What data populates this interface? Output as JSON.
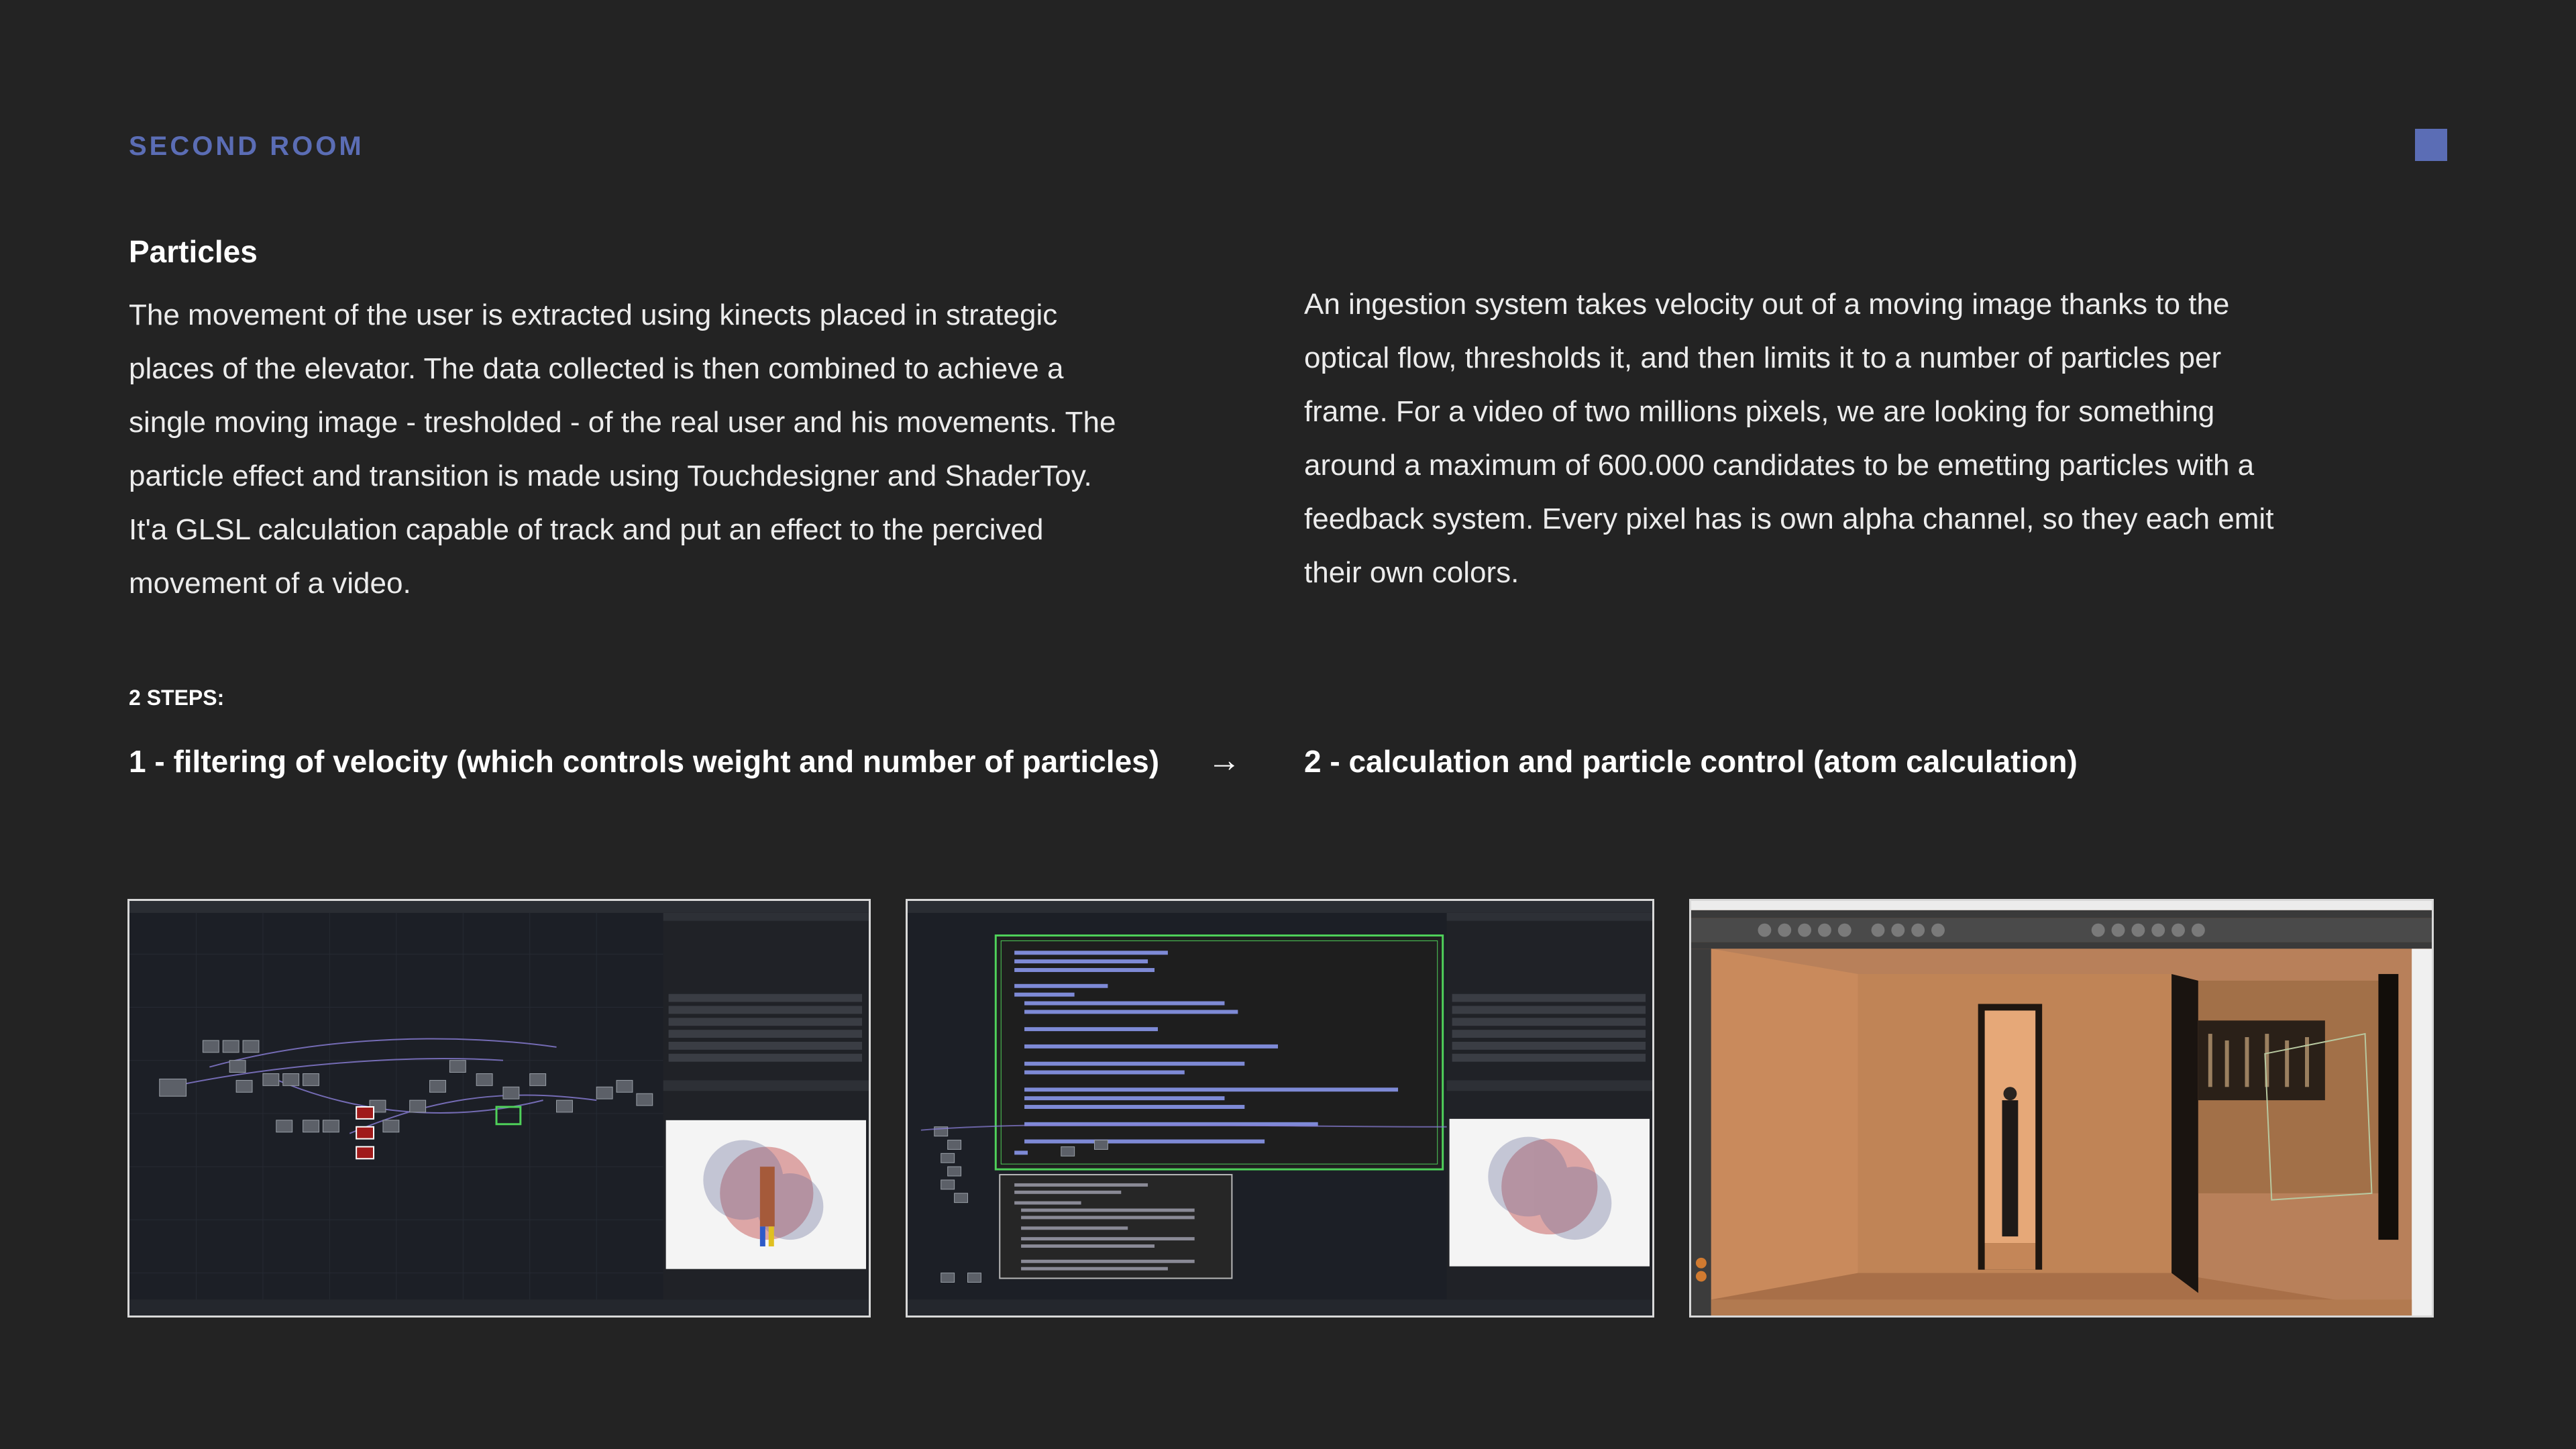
{
  "header": {
    "section_label": "SECOND ROOM",
    "accent_color": "#5b6db5"
  },
  "content": {
    "title": "Particles",
    "left_paragraph": "The movement of the user is extracted using kinects placed in strategic places of the elevator. The data collected is then combined to achieve a single moving image - tresholded - of the real user and his movements. The particle effect and transition is made using Touchdesigner and ShaderToy. It'a GLSL calculation capable of track and put an effect to the percived movement of a video.",
    "right_paragraph": "An ingestion system takes velocity out of a moving image thanks to the optical flow, thresholds it, and then limits it to a number of particles per frame. For a video of two millions pixels, we are looking for something around a maximum of 600.000 candidates to be emetting particles with a feedback system. Every pixel has is own alpha channel, so they each emit their own colors."
  },
  "steps": {
    "label": "2 STEPS:",
    "step1": "1 - filtering of velocity (which controls weight and number of particles)",
    "arrow": "→",
    "step2": "2 - calculation and particle control (atom calculation)"
  },
  "screenshots": [
    {
      "name": "touchdesigner-network-screenshot",
      "icon": "node-graph"
    },
    {
      "name": "glsl-shader-code-screenshot",
      "icon": "code-editor"
    },
    {
      "name": "cinema4d-viewport-screenshot",
      "icon": "3d-viewport"
    }
  ]
}
